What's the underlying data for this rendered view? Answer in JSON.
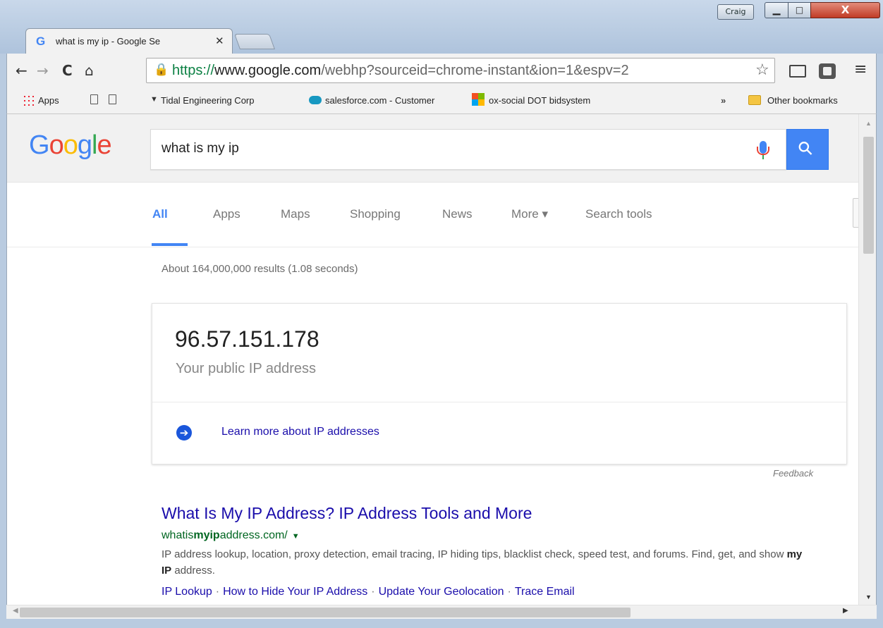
{
  "window": {
    "user_name": "Craig",
    "minimize_glyph": "▁",
    "maximize_glyph": "□",
    "close_glyph": "X"
  },
  "tab": {
    "favicon": "G",
    "title": "what is my ip - Google Se",
    "close": "✕"
  },
  "toolbar": {
    "back_icon": "←",
    "forward_icon": "→",
    "reload_icon": "C",
    "home_icon": "⌂",
    "lock_icon": "🔒",
    "url_scheme": "https://",
    "url_host": "www.google.com",
    "url_rest": "/webhp?sourceid=chrome-instant&ion=1&espv=2",
    "star_icon": "☆",
    "menu_icon": "≡"
  },
  "bookmarks": {
    "apps": "Apps",
    "tidal": "Tidal Engineering Corp",
    "tidal_icon": "▼",
    "salesforce": "salesforce.com - Customer",
    "oxsocial": "ox-social DOT bidsystem",
    "more": "»",
    "other": "Other bookmarks"
  },
  "search": {
    "query": "what is my ip",
    "button_icon": "⚲"
  },
  "search_tabs": {
    "all": "All",
    "apps": "Apps",
    "maps": "Maps",
    "shopping": "Shopping",
    "news": "News",
    "more": "More ▾",
    "tools": "Search tools"
  },
  "results": {
    "stats": "About 164,000,000 results (1.08 seconds)",
    "ip_value": "96.57.151.178",
    "ip_caption": "Your public IP address",
    "arrow_icon": "➔",
    "learn_more": "Learn more about IP addresses",
    "feedback": "Feedback",
    "first": {
      "title": "What Is My IP Address? IP Address Tools and More",
      "url_pre": "whatis",
      "url_bold": "myip",
      "url_post": "address.com/",
      "url_caret": "▼",
      "snippet_1": "IP address lookup, location, proxy detection, email tracing, IP hiding tips, blacklist check, speed test, and forums. Find, get, and show ",
      "snippet_bold": "my IP",
      "snippet_2": " address.",
      "sitelinks": [
        "IP Lookup",
        "How to Hide Your IP Address",
        "Update Your Geolocation",
        "Trace Email"
      ],
      "sitelink_sep": "·"
    }
  },
  "scrollbars": {
    "up": "▲",
    "down": "▼",
    "left": "◀",
    "right": "▶"
  },
  "colors": {
    "google_blue": "#4285f4",
    "link": "#1a0dab",
    "url_green": "#006621"
  }
}
